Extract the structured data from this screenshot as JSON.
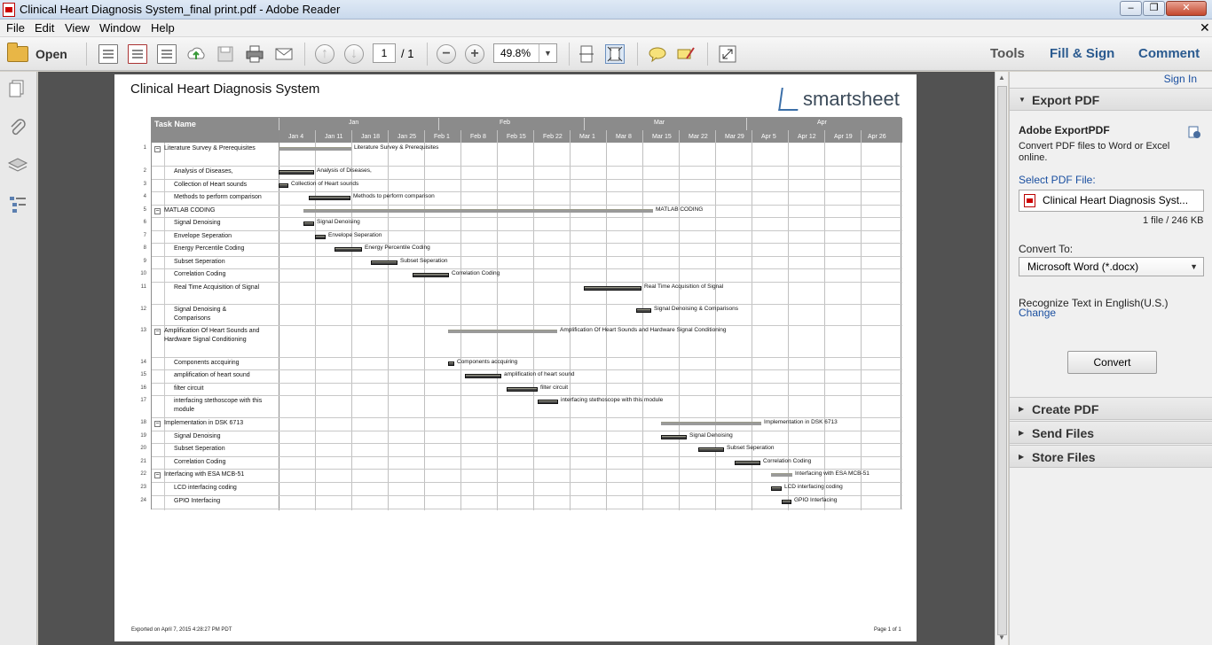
{
  "window": {
    "title": "Clinical Heart Diagnosis System_final print.pdf - Adobe Reader"
  },
  "menu": [
    "File",
    "Edit",
    "View",
    "Window",
    "Help"
  ],
  "toolbar": {
    "open_label": "Open",
    "page_current": "1",
    "page_total": "/ 1",
    "zoom": "49.8%",
    "tools": "Tools",
    "fill_sign": "Fill & Sign",
    "comment": "Comment"
  },
  "document": {
    "title": "Clinical Heart Diagnosis System",
    "logo_text": "smartsheet",
    "footer_left": "Exported on April 7, 2015 4:28:27 PM PDT",
    "footer_right": "Page 1 of 1",
    "gantt": {
      "task_header": "Task Name",
      "months": [
        "Jan",
        "Feb",
        "Mar",
        "Apr"
      ],
      "weeks": [
        "Jan 4",
        "Jan 11",
        "Jan 18",
        "Jan 25",
        "Feb 1",
        "Feb 8",
        "Feb 15",
        "Feb 22",
        "Mar 1",
        "Mar 8",
        "Mar 15",
        "Mar 22",
        "Mar 29",
        "Apr 5",
        "Apr 12",
        "Apr 19",
        "Apr 26"
      ],
      "rows": [
        {
          "num": "1",
          "name": "Literature Survey & Prerequisites",
          "label": "Literature Survey & Prerequisites",
          "level": 0
        },
        {
          "num": "2",
          "name": "Analysis of Diseases,",
          "label": "Analysis of Diseases,",
          "level": 1
        },
        {
          "num": "3",
          "name": "Collection of Heart sounds",
          "label": "Collection of Heart sounds",
          "level": 1
        },
        {
          "num": "4",
          "name": "Methods to perform comparison",
          "label": "Methods to perform comparison",
          "level": 1
        },
        {
          "num": "5",
          "name": "MATLAB CODING",
          "label": "MATLAB CODING",
          "level": 0
        },
        {
          "num": "6",
          "name": "Signal Denoising",
          "label": "Signal Denoising",
          "level": 1
        },
        {
          "num": "7",
          "name": "Envelope Seperation",
          "label": "Envelope Seperation",
          "level": 1
        },
        {
          "num": "8",
          "name": "Energy Percentile Coding",
          "label": "Energy Percentile Coding",
          "level": 1
        },
        {
          "num": "9",
          "name": "Subset Seperation",
          "label": "Subset Seperation",
          "level": 1
        },
        {
          "num": "10",
          "name": "Correlation Coding",
          "label": "Correlation Coding",
          "level": 1
        },
        {
          "num": "11",
          "name": "Real Time Acquisition of Signal",
          "label": "Real Time Acquisition of Signal",
          "level": 1
        },
        {
          "num": "12",
          "name": "Signal Denoising & Comparisons",
          "label": "Signal Denoising & Comparisons",
          "level": 1
        },
        {
          "num": "13",
          "name": "Amplification Of Heart Sounds and Hardware Signal Conditioning",
          "label": "Amplification Of Heart Sounds and Hardware Signal Conditioning",
          "level": 0
        },
        {
          "num": "14",
          "name": "Components accquiring",
          "label": "Components accquiring",
          "level": 1
        },
        {
          "num": "15",
          "name": "amplification of heart sound",
          "label": "amplification of heart sound",
          "level": 1
        },
        {
          "num": "16",
          "name": "filter circuit",
          "label": "filter circuit",
          "level": 1
        },
        {
          "num": "17",
          "name": "interfacing stethoscope with this module",
          "label": "interfacing stethoscope with this module",
          "level": 1
        },
        {
          "num": "18",
          "name": "Implementation in DSK 6713",
          "label": "Implementation in DSK 6713",
          "level": 0
        },
        {
          "num": "19",
          "name": "Signal Denoising",
          "label": "Signal Denoising",
          "level": 1
        },
        {
          "num": "20",
          "name": "Subset Seperation",
          "label": "Subset Seperation",
          "level": 1
        },
        {
          "num": "21",
          "name": "Correlation Coding",
          "label": "Correlation Coding",
          "level": 1
        },
        {
          "num": "22",
          "name": "Interfacing with ESA MCB-51",
          "label": "Interfacing with ESA MCB-51",
          "level": 0
        },
        {
          "num": "23",
          "name": "LCD interfacing coding",
          "label": "LCD interfacing coding",
          "level": 1
        },
        {
          "num": "24",
          "name": "GPIO Interfacing",
          "label": "GPIO Interfacing",
          "level": 1
        }
      ]
    }
  },
  "right_panel": {
    "sign_in": "Sign In",
    "export_pdf": "Export PDF",
    "adobe_exportpdf": "Adobe ExportPDF",
    "description": "Convert PDF files to Word or Excel online.",
    "select_pdf": "Select PDF File:",
    "file_name": "Clinical Heart Diagnosis Syst...",
    "file_info": "1 file / 246 KB",
    "convert_to": "Convert To:",
    "format": "Microsoft Word (*.docx)",
    "recognize": "Recognize Text in English(U.S.)",
    "change": "Change",
    "convert_button": "Convert",
    "create_pdf": "Create PDF",
    "send_files": "Send Files",
    "store_files": "Store Files"
  }
}
